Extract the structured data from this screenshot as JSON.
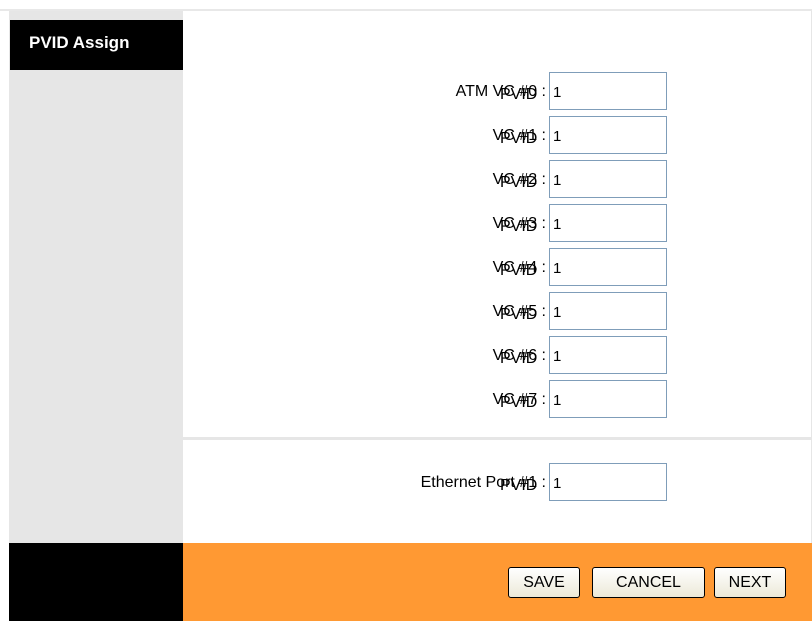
{
  "section": {
    "title": "PVID Assign"
  },
  "atm_vcs": [
    {
      "label": "ATM VC #0 :",
      "pvid_label": "PVID",
      "value": "1"
    },
    {
      "label": "VC #1 :",
      "pvid_label": "PVID",
      "value": "1"
    },
    {
      "label": "VC #2 :",
      "pvid_label": "PVID",
      "value": "1"
    },
    {
      "label": "VC #3 :",
      "pvid_label": "PVID",
      "value": "1"
    },
    {
      "label": "VC #4 :",
      "pvid_label": "PVID",
      "value": "1"
    },
    {
      "label": "VC #5 :",
      "pvid_label": "PVID",
      "value": "1"
    },
    {
      "label": "VC #6 :",
      "pvid_label": "PVID",
      "value": "1"
    },
    {
      "label": "VC #7 :",
      "pvid_label": "PVID",
      "value": "1"
    }
  ],
  "ethernet": {
    "label": "Ethernet Port #1 :",
    "pvid_label": "PVID",
    "value": "1"
  },
  "buttons": {
    "save": "SAVE",
    "cancel": "CANCEL",
    "next": "NEXT"
  },
  "colors": {
    "footer_accent": "#ff9933",
    "sidebar": "#e6e6e6",
    "header_block": "#000000"
  }
}
